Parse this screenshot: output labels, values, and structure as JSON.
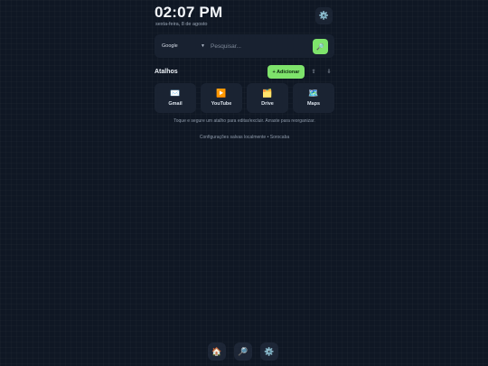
{
  "header": {
    "time": "02:07 PM",
    "date": "sexta-feira, 8 de agosto",
    "settings_icon": "⚙️"
  },
  "search": {
    "engine": "Google",
    "placeholder": "Pesquisar...",
    "button_icon": "🔎"
  },
  "shortcuts": {
    "title": "Atalhos",
    "add_label": "+ Adicionar",
    "move_up": "⇧",
    "move_down": "⇩",
    "items": [
      {
        "label": "Gmail",
        "icon": "✉️"
      },
      {
        "label": "YouTube",
        "icon": "▶️"
      },
      {
        "label": "Drive",
        "icon": "🗂️"
      },
      {
        "label": "Maps",
        "icon": "🗺️"
      }
    ],
    "hint": "Toque e segure um atalho para editar/excluir. Arraste para reorganizar."
  },
  "footer": {
    "note": "Configurações salvas localmente • Sorocaba"
  },
  "dock": {
    "home_icon": "🏠",
    "search_icon": "🔎",
    "settings_icon": "⚙️"
  },
  "colors": {
    "background": "#0f1724",
    "accent": "#7ee36b",
    "card": "#1a2332"
  }
}
